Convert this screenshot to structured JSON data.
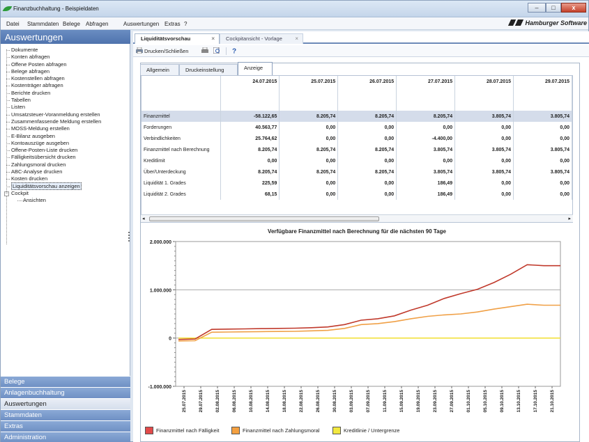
{
  "window": {
    "title": "Finanzbuchhaltung - Beispieldaten",
    "btn_min": "–",
    "btn_max": "□",
    "btn_close": "x"
  },
  "menu": {
    "items": [
      "Datei",
      "Stammdaten",
      "Belege",
      "Abfragen",
      "Auswertungen",
      "Extras",
      "?"
    ],
    "brand": "Hamburger Software"
  },
  "sidebar": {
    "title": "Auswertungen",
    "items": [
      "Dokumente",
      "Konten abfragen",
      "Offene Posten abfragen",
      "Belege abfragen",
      "Kostenstellen abfragen",
      "Kostenträger abfragen",
      "Berichte drucken",
      "Tabellen",
      "Listen",
      "Umsatzsteuer-Voranmeldung erstellen",
      "Zusammenfassende Meldung erstellen",
      "MOSS-Meldung erstellen",
      "E-Bilanz ausgeben",
      "Kontoauszüge ausgeben",
      "Offene-Posten-Liste drucken",
      "Fälligkeitsübersicht drucken",
      "Zahlungsmoral drucken",
      "ABC-Analyse drucken",
      "Kosten drucken",
      "Liquiditätsvorschau anzeigen"
    ],
    "cockpit": "Cockpit",
    "cockpit_child": "Ansichten",
    "sections": [
      "Belege",
      "Anlagenbuchhaltung",
      "Auswertungen",
      "Stammdaten",
      "Extras",
      "Administration"
    ]
  },
  "doc_tabs": [
    "Liquiditätsvorschau",
    "Cockpitansicht - Vorlage"
  ],
  "toolbar": {
    "print_label": "Drucken/Schließen"
  },
  "sub_tabs": [
    "Allgemein",
    "Druckeinstellung",
    "Anzeige"
  ],
  "grid": {
    "columns": [
      "24.07.2015",
      "25.07.2015",
      "26.07.2015",
      "27.07.2015",
      "28.07.2015",
      "29.07.2015"
    ],
    "rows": [
      {
        "label": "Finanzmittel",
        "values": [
          "-58.122,65",
          "8.205,74",
          "8.205,74",
          "8.205,74",
          "3.805,74",
          "3.805,74"
        ]
      },
      {
        "label": "Forderungen",
        "values": [
          "40.563,77",
          "0,00",
          "0,00",
          "0,00",
          "0,00",
          "0,00"
        ]
      },
      {
        "label": "Verbindlichkeiten",
        "values": [
          "25.764,62",
          "0,00",
          "0,00",
          "-4.400,00",
          "0,00",
          "0,00"
        ]
      },
      {
        "label": "Finanzmittel nach Berechnung",
        "values": [
          "8.205,74",
          "8.205,74",
          "8.205,74",
          "3.805,74",
          "3.805,74",
          "3.805,74"
        ]
      },
      {
        "label": "Kreditlimit",
        "values": [
          "0,00",
          "0,00",
          "0,00",
          "0,00",
          "0,00",
          "0,00"
        ]
      },
      {
        "label": "Über/Unterdeckung",
        "values": [
          "8.205,74",
          "8.205,74",
          "8.205,74",
          "3.805,74",
          "3.805,74",
          "3.805,74"
        ]
      },
      {
        "label": "Liquidität 1. Grades",
        "values": [
          "225,59",
          "0,00",
          "0,00",
          "186,49",
          "0,00",
          "0,00"
        ]
      },
      {
        "label": "Liquidität 2. Grades",
        "values": [
          "68,15",
          "0,00",
          "0,00",
          "186,49",
          "0,00",
          "0,00"
        ]
      }
    ]
  },
  "colors": {
    "series1": "#c0392b",
    "series2": "#f0a046",
    "series3": "#f2e03a",
    "accent": "#4f73ad"
  },
  "chart_data": {
    "type": "line",
    "title": "Verfügbare Finanzmittel nach Berechnung für die nächsten 90 Tage",
    "ylim": [
      -1000000,
      2000000
    ],
    "yticks": [
      "-1.000.000",
      "0",
      "1.000.000",
      "2.000.000"
    ],
    "ytick_values": [
      -1000000,
      0,
      1000000,
      2000000
    ],
    "x_labels": [
      "25.07.2015",
      "29.07.2015",
      "02.08.2015",
      "06.08.2015",
      "10.08.2015",
      "14.08.2015",
      "18.08.2015",
      "22.08.2015",
      "26.08.2015",
      "30.08.2015",
      "03.09.2015",
      "07.09.2015",
      "11.09.2015",
      "15.09.2015",
      "19.09.2015",
      "23.09.2015",
      "27.09.2015",
      "01.10.2015",
      "05.10.2015",
      "09.10.2015",
      "13.10.2015",
      "17.10.2015",
      "21.10.2015"
    ],
    "series": [
      {
        "name": "Finanzmittel nach Fälligkeit",
        "color": "#c0392b",
        "values": [
          -30000,
          -20000,
          180000,
          185000,
          190000,
          195000,
          200000,
          205000,
          215000,
          230000,
          280000,
          370000,
          400000,
          460000,
          580000,
          680000,
          820000,
          920000,
          1010000,
          1150000,
          1320000,
          1520000,
          1500000,
          1500000
        ]
      },
      {
        "name": "Finanzmittel nach Zahlungsmoral",
        "color": "#f0a046",
        "values": [
          -60000,
          -55000,
          120000,
          125000,
          130000,
          133000,
          136000,
          140000,
          150000,
          160000,
          200000,
          280000,
          300000,
          340000,
          400000,
          450000,
          480000,
          500000,
          540000,
          600000,
          650000,
          700000,
          680000,
          680000
        ]
      },
      {
        "name": "Kreditlinie / Untergrenze",
        "color": "#f2e03a",
        "values": [
          0,
          0,
          0,
          0,
          0,
          0,
          0,
          0,
          0,
          0,
          0,
          0,
          0,
          0,
          0,
          0,
          0,
          0,
          0,
          0,
          0,
          0,
          0,
          0
        ]
      }
    ]
  }
}
